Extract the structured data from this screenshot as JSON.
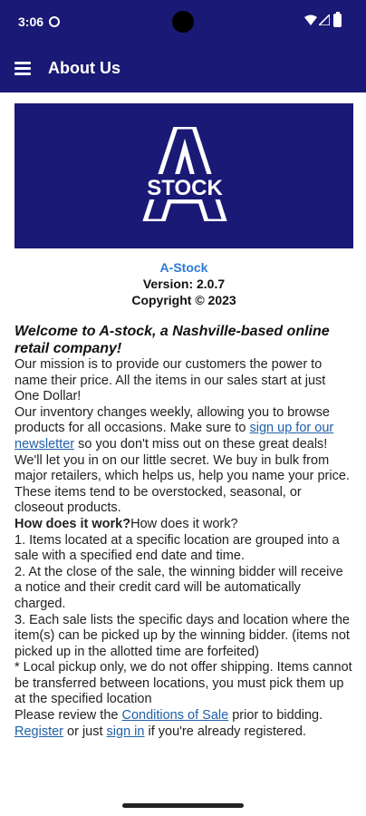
{
  "status_bar": {
    "time": "3:06"
  },
  "app_bar": {
    "title": "About Us"
  },
  "logo": {
    "text": "STOCK",
    "letter": "A"
  },
  "app_info": {
    "name": "A-Stock",
    "version": "Version: 2.0.7",
    "copyright": "Copyright © 2023"
  },
  "about": {
    "welcome": "Welcome to A-stock, a Nashville-based online retail company!",
    "mission": "Our mission is to provide our customers the power to name their price. All the items in our sales start at just One Dollar!",
    "inventory_pre": "Our inventory changes weekly, allowing you to browse products for all occasions. Make sure to ",
    "newsletter_link": "sign up for our newsletter",
    "inventory_post": " so you don't miss out on these great deals!",
    "secret": "We'll let you in on our little secret. We buy in bulk from major retailers, which helps us, help you name your price. These items tend to be overstocked, seasonal, or closeout products.",
    "how_heading": "How does it work?",
    "how_repeat": "How does it work?",
    "step1": "1. Items located at a specific location are grouped into a sale with a specified end date and time.",
    "step2": "2. At the close of the sale, the winning bidder will receive a notice and their credit card will be automatically charged.",
    "step3": "3. Each sale lists the specific days and location where the item(s) can be picked up by the winning bidder.  (items not picked up in the allotted time are forfeited)",
    "local_pickup": "* Local pickup only, we do not offer shipping. Items cannot be transferred between locations, you must pick them up at the specified location",
    "review_pre": "Please review the ",
    "conditions_link": "Conditions of Sale",
    "review_post": " prior to bidding.",
    "register_link": "Register",
    "or_just": " or just ",
    "signin_link": "sign in",
    "registered_post": " if you're already registered."
  }
}
